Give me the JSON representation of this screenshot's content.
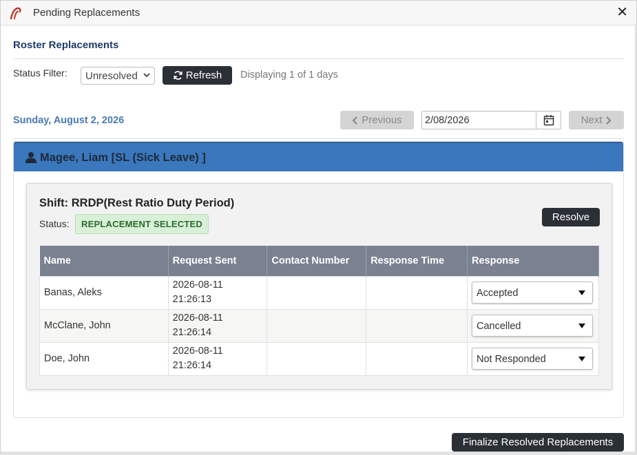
{
  "window": {
    "title": "Pending Replacements",
    "close_label": "✕"
  },
  "header": {
    "title": "Roster Replacements"
  },
  "filter": {
    "label": "Status Filter:",
    "selected": "Unresolved",
    "refresh_label": "Refresh",
    "displaying": "Displaying 1 of 1 days"
  },
  "date_nav": {
    "current_date": "Sunday, August 2, 2026",
    "previous_label": "Previous",
    "date_value": "2/08/2026",
    "next_label": "Next"
  },
  "employee": {
    "name": "Magee, Liam [SL (Sick Leave) ]"
  },
  "shift": {
    "title": "Shift: RRDP(Rest Ratio Duty Period)",
    "status_label": "Status:",
    "status_value": "REPLACEMENT SELECTED",
    "resolve_label": "Resolve",
    "status_color": "#2d6b2d"
  },
  "table": {
    "columns": [
      "Name",
      "Request Sent",
      "Contact Number",
      "Response Time",
      "Response"
    ],
    "rows": [
      {
        "name": "Banas, Aleks",
        "sent_date": "2026-08-11",
        "sent_time": "21:26:13",
        "contact": "",
        "response_time": "",
        "response": "Accepted"
      },
      {
        "name": "McClane, John",
        "sent_date": "2026-08-11",
        "sent_time": "21:26:14",
        "contact": "",
        "response_time": "",
        "response": "Cancelled"
      },
      {
        "name": "Doe, John",
        "sent_date": "2026-08-11",
        "sent_time": "21:26:14",
        "contact": "",
        "response_time": "",
        "response": "Not Responded"
      }
    ]
  },
  "footer": {
    "finalize_label": "Finalize Resolved Replacements"
  },
  "colors": {
    "accent": "#3a77bc",
    "dark_button": "#2b2f36",
    "heading": "#1f3b6b",
    "date": "#4a79b0"
  },
  "icons": {
    "app": "fibre-logo-icon",
    "refresh": "refresh-icon",
    "user": "user-icon",
    "calendar": "calendar-icon"
  }
}
